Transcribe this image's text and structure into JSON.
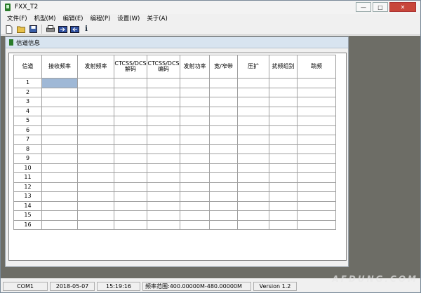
{
  "window": {
    "title": "FXX_T2",
    "minimize": "—",
    "maximize": "□",
    "close": "✕"
  },
  "menu": [
    "文件(F)",
    "机型(M)",
    "编辑(E)",
    "编程(P)",
    "设置(W)",
    "关于(A)"
  ],
  "toolbar": {
    "icons": [
      "new-file-icon",
      "open-folder-icon",
      "save-icon",
      "print-icon",
      "read-radio-icon",
      "write-radio-icon",
      "info-icon"
    ]
  },
  "channel_window": {
    "title": "信道信息",
    "columns": [
      "信道",
      "接收频率",
      "发射频率",
      "CTCSS/DCS\n解码",
      "CTCSS/DCS\n编码",
      "发射功率",
      "宽/窄带",
      "压扩",
      "扰频组别",
      "跳频"
    ],
    "rows": [
      "1",
      "2",
      "3",
      "4",
      "5",
      "6",
      "7",
      "8",
      "9",
      "10",
      "11",
      "12",
      "13",
      "14",
      "15",
      "16"
    ]
  },
  "status": {
    "port": "COM1",
    "date": "2018-05-07",
    "time": "15:19:16",
    "freq_range": "频率范围:400.00000M-480.00000M",
    "version": "Version 1.2"
  },
  "watermark": "AFDUNG.COM"
}
